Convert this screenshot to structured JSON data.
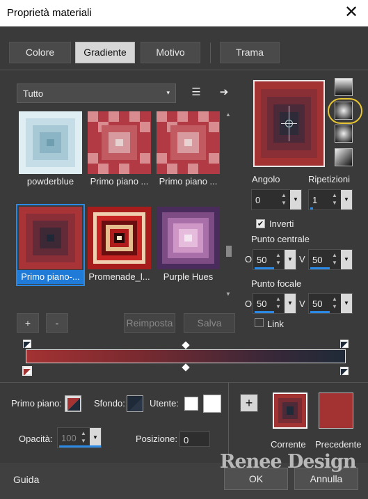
{
  "window": {
    "title": "Proprietà materiali",
    "close": "✕"
  },
  "tabs": [
    "Colore",
    "Gradiente",
    "Motivo",
    "Trama"
  ],
  "category": {
    "value": "Tutto",
    "arrow": "▾"
  },
  "icons": {
    "list": "☰",
    "arrow": "➔"
  },
  "gradients": [
    {
      "label": "powderblue",
      "inner": "#6f9eb0",
      "outer": "#dfeef3"
    },
    {
      "label": "Primo piano ...",
      "inner": "#e7d2d2",
      "outer": "#b13a44"
    },
    {
      "label": "Primo piano ...",
      "inner": "#e7d2d2",
      "outer": "#b13a44"
    },
    {
      "label": "Primo piano-...",
      "inner": "#1e2836",
      "outer": "#a83438"
    },
    {
      "label": "Promenade_l...",
      "inner": "#f0e6c8",
      "outer": "#a81c1c"
    },
    {
      "label": "Purple Hues",
      "inner": "#f4e6f0",
      "outer": "#4a2c5c"
    }
  ],
  "buttons": {
    "add": "+",
    "remove": "-",
    "reset": "Reimposta",
    "save": "Salva"
  },
  "params": {
    "angle_label": "Angolo",
    "angle": "0",
    "repeat_label": "Ripetizioni",
    "repeat": "1",
    "invert_label": "Inverti",
    "invert_check": "✔",
    "center_label": "Punto centrale",
    "focal_label": "Punto focale",
    "link_label": "Link",
    "o_label": "O",
    "v_label": "V",
    "center_o": "50",
    "center_v": "50",
    "focal_o": "50",
    "focal_v": "50"
  },
  "bottom": {
    "fg_label": "Primo piano:",
    "bg_label": "Sfondo:",
    "user_label": "Utente:",
    "opacity_label": "Opacità:",
    "opacity": "100",
    "position_label": "Posizione:",
    "position": "0",
    "add": "+",
    "current_label": "Corrente",
    "previous_label": "Precedente",
    "help": "Guida",
    "ok": "OK",
    "cancel": "Annulla"
  },
  "watermark": "Renee Design",
  "colors": {
    "foreground": "#a33233",
    "background": "#1f2a38",
    "previous": "#a33233",
    "accent": "#2a8ae6"
  }
}
